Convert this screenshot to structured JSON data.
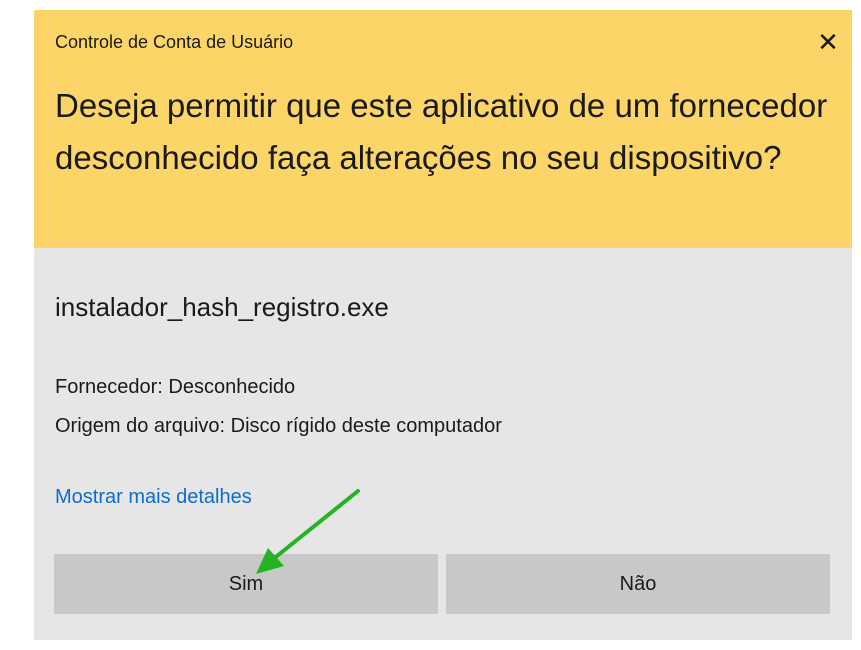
{
  "dialog": {
    "title": "Controle de Conta de Usuário",
    "question": "Deseja permitir que este aplicativo de um fornecedor desconhecido faça alterações no seu dispositivo?",
    "close_glyph": "✕",
    "filename": "instalador_hash_registro.exe",
    "vendor": "Fornecedor: Desconhecido",
    "origin": "Origem do arquivo: Disco rígido deste computador",
    "details_link": "Mostrar mais detalhes",
    "yes_label": "Sim",
    "no_label": "Não"
  },
  "colors": {
    "header_bg": "#fcd569",
    "body_bg": "#e6e6e6",
    "button_bg": "#c8c8c8",
    "link": "#0a6ed1",
    "annotation_arrow": "#22b422"
  },
  "icons": {
    "close": "close-icon",
    "annotation": "green-arrow-annotation"
  }
}
